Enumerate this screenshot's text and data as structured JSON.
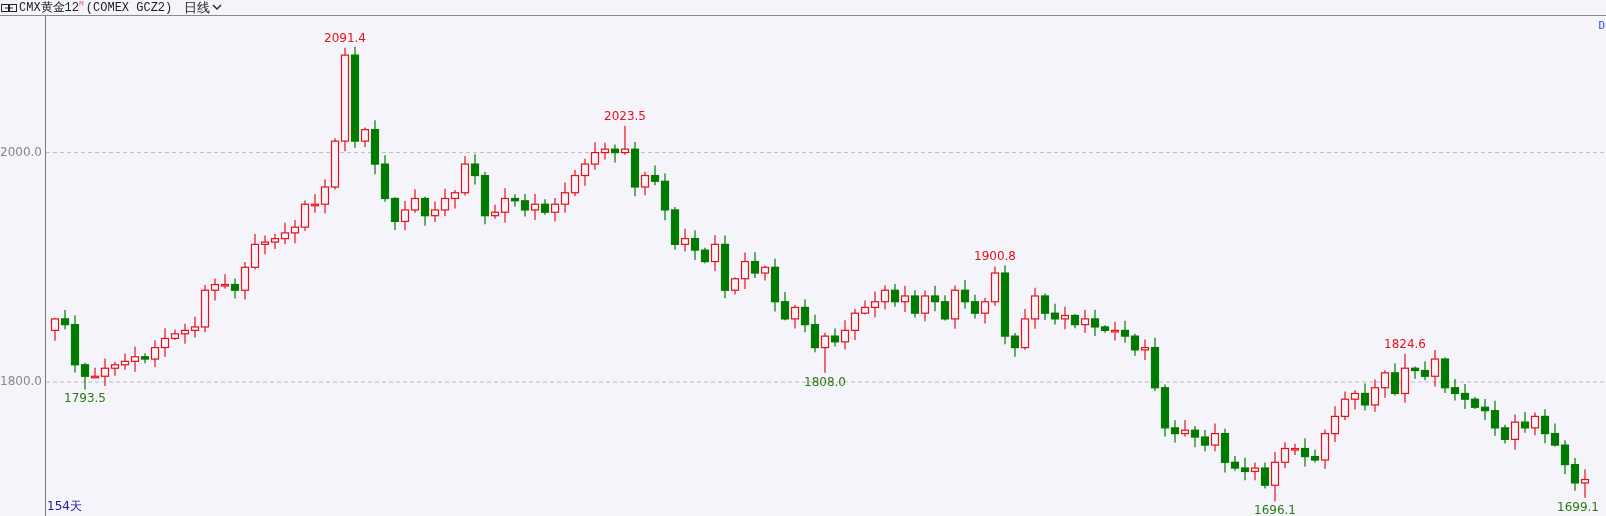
{
  "header": {
    "title": "CMX黄金12$^{M}$",
    "code": "(COMEX GCZ2)",
    "period": "日线"
  },
  "chart": {
    "y_axis_labels": [
      "2000.0",
      "1800.0"
    ],
    "annotations": [
      {
        "text": "1793.5",
        "kind": "low"
      },
      {
        "text": "2091.4",
        "kind": "high"
      },
      {
        "text": "2023.5",
        "kind": "high"
      },
      {
        "text": "1808.0",
        "kind": "low"
      },
      {
        "text": "1900.8",
        "kind": "high"
      },
      {
        "text": "1696.1",
        "kind": "low"
      },
      {
        "text": "1824.6",
        "kind": "high"
      },
      {
        "text": "1699.1",
        "kind": "low"
      }
    ],
    "corner_mark": "D",
    "day_count": "154天"
  }
}
